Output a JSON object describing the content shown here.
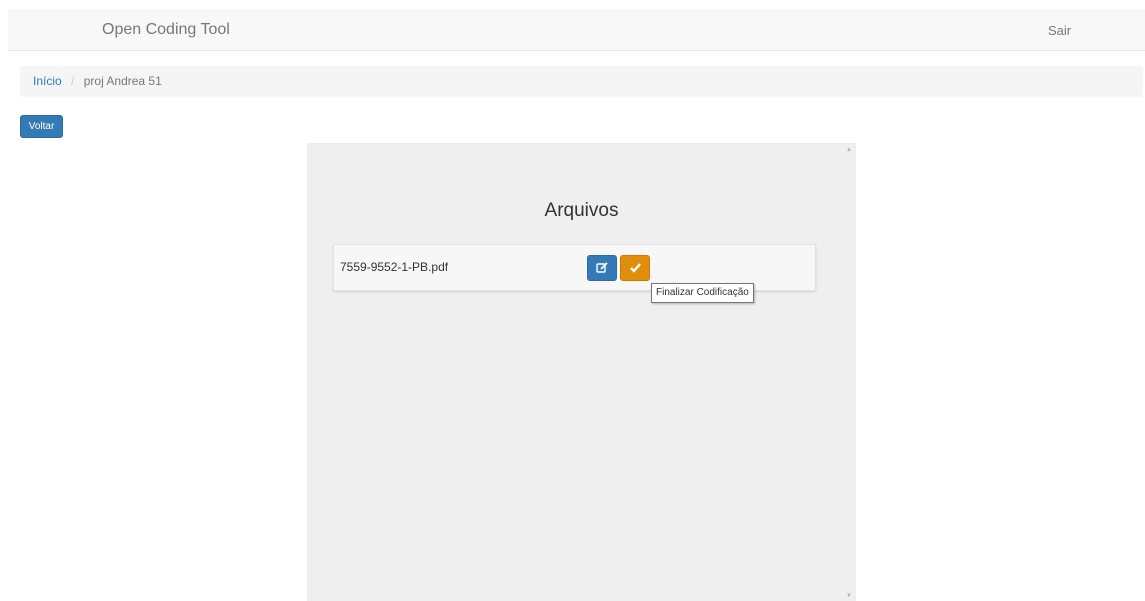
{
  "navbar": {
    "brand": "Open Coding Tool",
    "logout_label": "Sair"
  },
  "breadcrumb": {
    "home_label": "Início",
    "separator": "/",
    "current": "proj Andrea 51"
  },
  "back_button_label": "Voltar",
  "panel": {
    "title": "Arquivos",
    "files": [
      {
        "name": "7559-9552-1-PB.pdf",
        "edit_icon": "edit-icon",
        "finish_icon": "check-icon"
      }
    ]
  },
  "tooltip": "Finalizar Codificação",
  "colors": {
    "primary": "#337ab7",
    "warning": "#e08e0b",
    "navbar_bg": "#f8f8f8",
    "panel_bg": "#efefef"
  }
}
